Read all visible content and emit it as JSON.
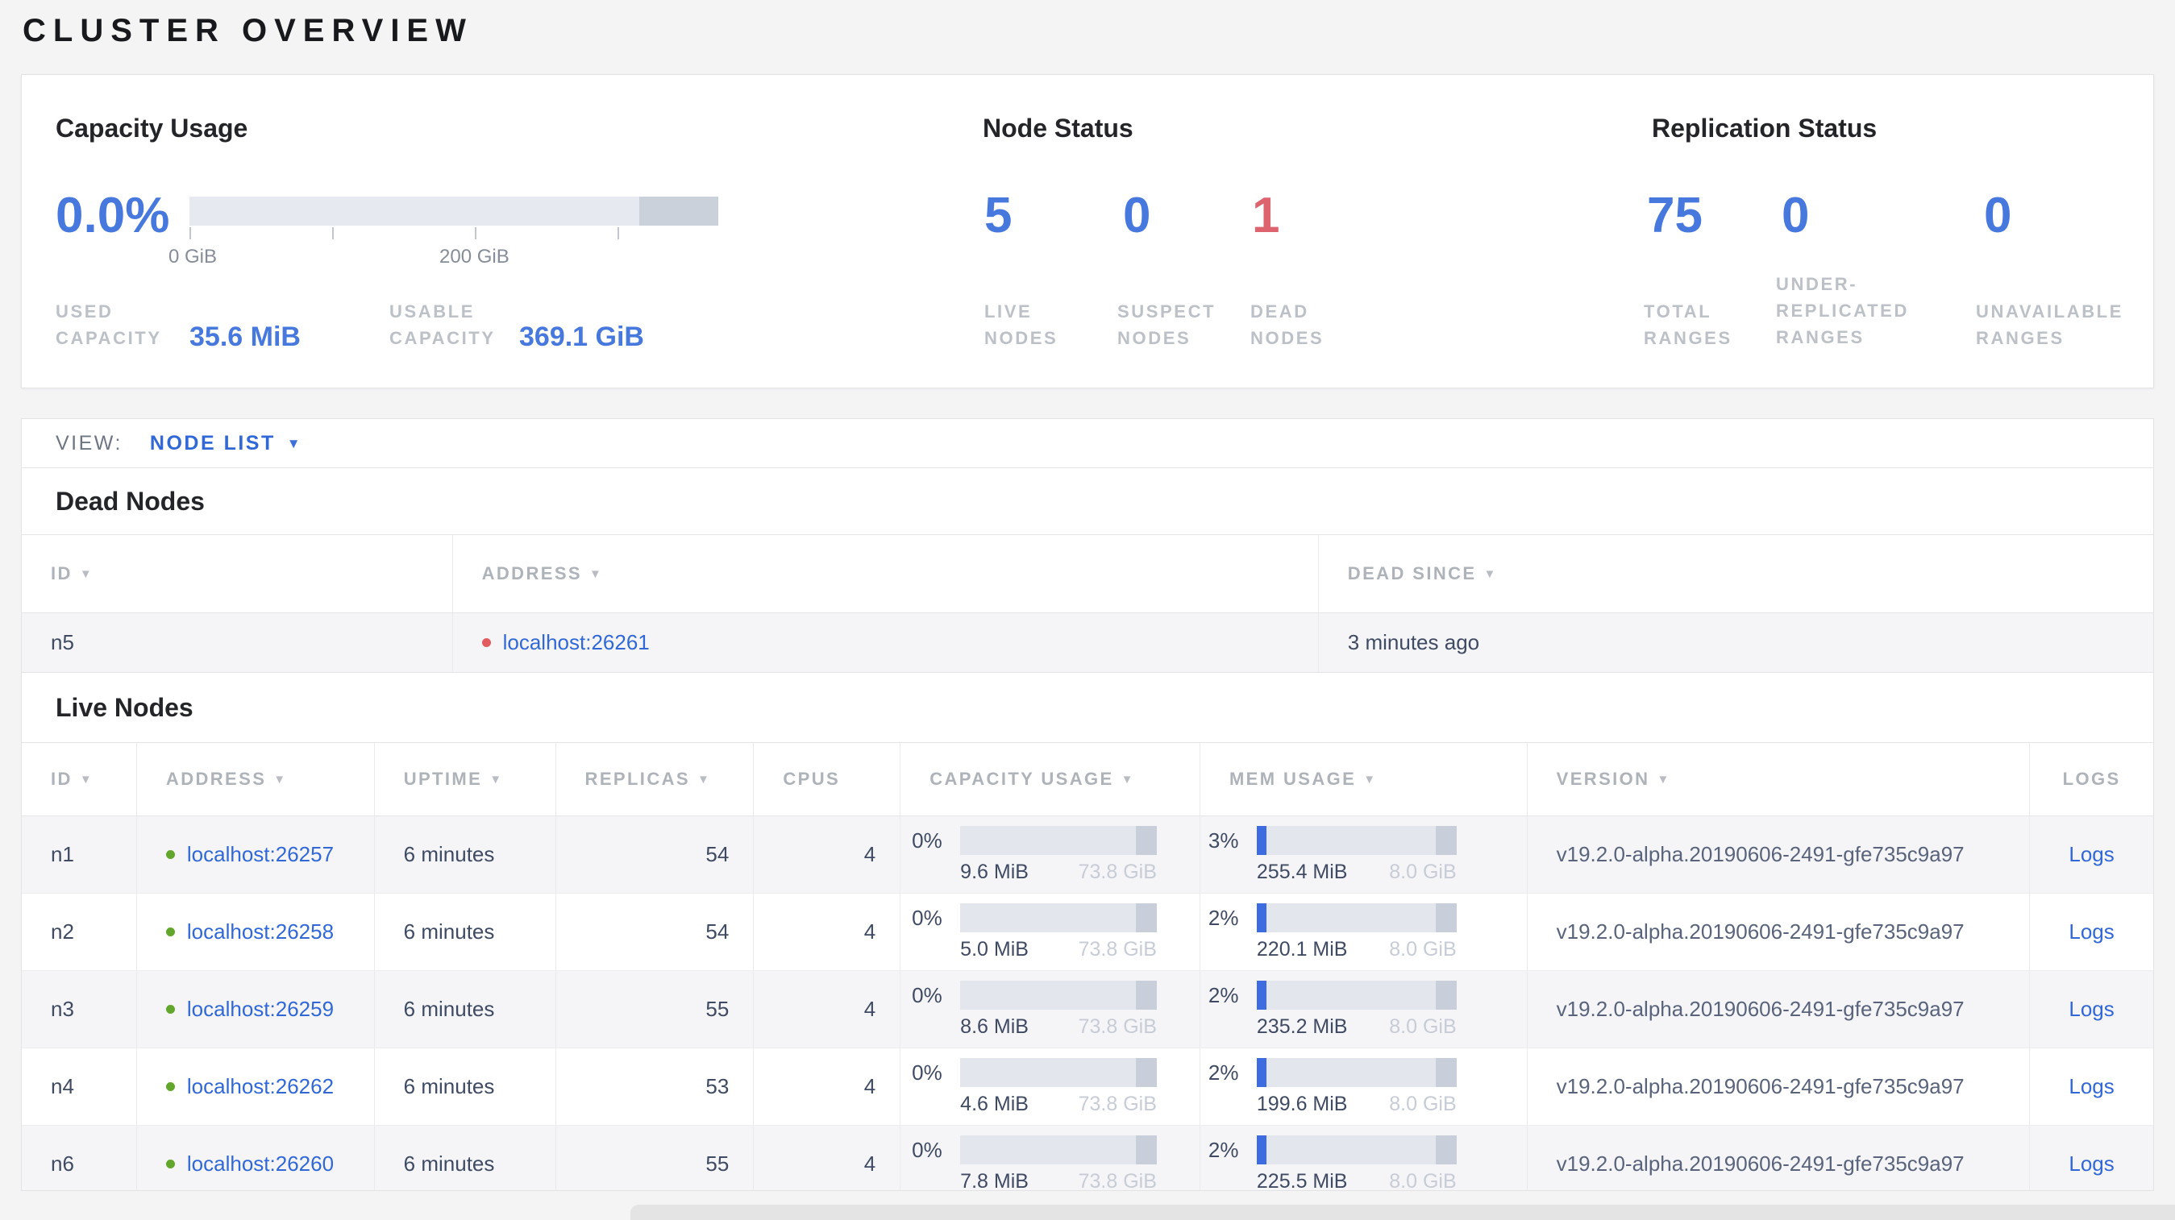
{
  "page": {
    "title": "CLUSTER OVERVIEW"
  },
  "icons": {
    "sort": "▼",
    "dropdown": "▼",
    "live_dot": "green-circle",
    "dead_dot": "red-circle"
  },
  "colors": {
    "accent_blue": "#4678dd",
    "link_blue": "#3168d8",
    "danger_red": "#dd636e",
    "live_green": "#63a62c",
    "dead_red": "#e25b5e",
    "bar_track": "#e3e6ed",
    "bar_tail": "#c9cfda",
    "bar_fill": "#3d6ce0",
    "page_bg": "#f4f4f5"
  },
  "summary": {
    "capacity": {
      "title": "Capacity Usage",
      "percent": "0.0%",
      "tick_labels": [
        "0 GiB",
        "200 GiB"
      ],
      "used_label": "USED CAPACITY",
      "used_value": "35.6 MiB",
      "usable_label": "USABLE CAPACITY",
      "usable_value": "369.1 GiB"
    },
    "node_status": {
      "title": "Node Status",
      "stats": [
        {
          "value": "5",
          "label": "LIVE NODES"
        },
        {
          "value": "0",
          "label": "SUSPECT NODES"
        },
        {
          "value": "1",
          "label": "DEAD NODES"
        }
      ]
    },
    "replication": {
      "title": "Replication Status",
      "stats": [
        {
          "value": "75",
          "label": "TOTAL RANGES"
        },
        {
          "value": "0",
          "label": "UNDER-REPLICATED RANGES"
        },
        {
          "value": "0",
          "label": "UNAVAILABLE RANGES"
        }
      ]
    }
  },
  "view_bar": {
    "label": "VIEW:",
    "selected": "NODE LIST"
  },
  "dead_nodes": {
    "title": "Dead Nodes",
    "columns": [
      {
        "label": "ID",
        "sortable": true
      },
      {
        "label": "ADDRESS",
        "sortable": true
      },
      {
        "label": "DEAD SINCE",
        "sortable": true
      }
    ],
    "rows": [
      {
        "id": "n5",
        "address": "localhost:26261",
        "dead_since": "3 minutes ago"
      }
    ]
  },
  "live_nodes": {
    "title": "Live Nodes",
    "logs_label": "Logs",
    "columns": [
      {
        "label": "ID",
        "sortable": true
      },
      {
        "label": "ADDRESS",
        "sortable": true
      },
      {
        "label": "UPTIME",
        "sortable": true
      },
      {
        "label": "REPLICAS",
        "sortable": true
      },
      {
        "label": "CPUS",
        "sortable": false
      },
      {
        "label": "CAPACITY USAGE",
        "sortable": true
      },
      {
        "label": "MEM USAGE",
        "sortable": true
      },
      {
        "label": "VERSION",
        "sortable": true
      },
      {
        "label": "LOGS",
        "sortable": false
      }
    ],
    "rows": [
      {
        "id": "n1",
        "address": "localhost:26257",
        "uptime": "6 minutes",
        "replicas": "54",
        "cpus": "4",
        "capacity_percent": "0%",
        "capacity_used": "9.6 MiB",
        "capacity_total": "73.8 GiB",
        "mem_percent": "3%",
        "mem_used": "255.4 MiB",
        "mem_total": "8.0 GiB",
        "version": "v19.2.0-alpha.20190606-2491-gfe735c9a97"
      },
      {
        "id": "n2",
        "address": "localhost:26258",
        "uptime": "6 minutes",
        "replicas": "54",
        "cpus": "4",
        "capacity_percent": "0%",
        "capacity_used": "5.0 MiB",
        "capacity_total": "73.8 GiB",
        "mem_percent": "2%",
        "mem_used": "220.1 MiB",
        "mem_total": "8.0 GiB",
        "version": "v19.2.0-alpha.20190606-2491-gfe735c9a97"
      },
      {
        "id": "n3",
        "address": "localhost:26259",
        "uptime": "6 minutes",
        "replicas": "55",
        "cpus": "4",
        "capacity_percent": "0%",
        "capacity_used": "8.6 MiB",
        "capacity_total": "73.8 GiB",
        "mem_percent": "2%",
        "mem_used": "235.2 MiB",
        "mem_total": "8.0 GiB",
        "version": "v19.2.0-alpha.20190606-2491-gfe735c9a97"
      },
      {
        "id": "n4",
        "address": "localhost:26262",
        "uptime": "6 minutes",
        "replicas": "53",
        "cpus": "4",
        "capacity_percent": "0%",
        "capacity_used": "4.6 MiB",
        "capacity_total": "73.8 GiB",
        "mem_percent": "2%",
        "mem_used": "199.6 MiB",
        "mem_total": "8.0 GiB",
        "version": "v19.2.0-alpha.20190606-2491-gfe735c9a97"
      },
      {
        "id": "n6",
        "address": "localhost:26260",
        "uptime": "6 minutes",
        "replicas": "55",
        "cpus": "4",
        "capacity_percent": "0%",
        "capacity_used": "7.8 MiB",
        "capacity_total": "73.8 GiB",
        "mem_percent": "2%",
        "mem_used": "225.5 MiB",
        "mem_total": "8.0 GiB",
        "version": "v19.2.0-alpha.20190606-2491-gfe735c9a97"
      }
    ]
  }
}
